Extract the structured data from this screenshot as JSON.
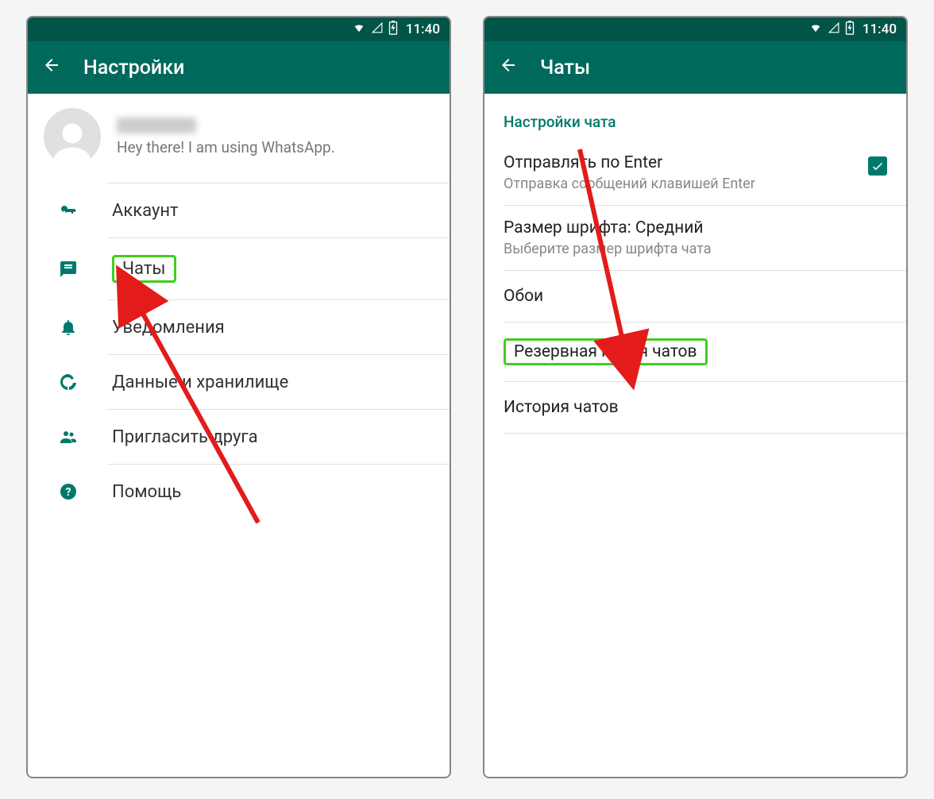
{
  "status": {
    "time": "11:40"
  },
  "left": {
    "title": "Настройки",
    "profile": {
      "status_msg": "Hey there! I am using WhatsApp."
    },
    "menu": {
      "account": "Аккаунт",
      "chats": "Чаты",
      "notifications": "Уведомления",
      "data": "Данные и хранилище",
      "invite": "Пригласить друга",
      "help": "Помощь"
    }
  },
  "right": {
    "title": "Чаты",
    "section": "Настройки чата",
    "enter_send": {
      "primary": "Отправлять по Enter",
      "secondary": "Отправка сообщений клавишей Enter"
    },
    "font_size": {
      "primary": "Размер шрифта: Средний",
      "secondary": "Выберите размер шрифта чата"
    },
    "wallpaper": "Обои",
    "backup": "Резервная копия чатов",
    "history": "История чатов"
  }
}
